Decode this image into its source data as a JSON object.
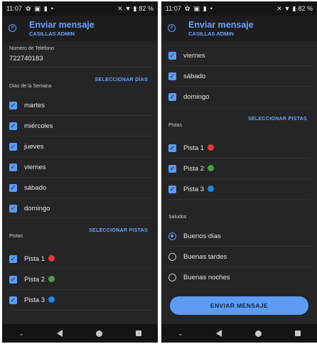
{
  "status": {
    "time": "11:07",
    "battery": "82 %"
  },
  "header": {
    "title": "Enviar mensaje",
    "subtitle": "CASILLAS ADMIN"
  },
  "colors": {
    "accent": "#5b9bf4",
    "background": "#252527",
    "red": "#e53935",
    "green": "#43a047",
    "blue": "#1e88e5"
  },
  "phone_field": {
    "label": "Número de Teléfono",
    "value": "722740183"
  },
  "days": {
    "label": "Días de la Semana",
    "select_label": "SELECCIONAR DÍAS",
    "items": [
      "martes",
      "miércoles",
      "jueves",
      "viernes",
      "sábado",
      "domingo"
    ]
  },
  "tracks": {
    "label": "Pistas",
    "select_label": "SELECCIONAR PISTAS",
    "items": [
      "Pista 1",
      "Pista 2",
      "Pista 3"
    ]
  },
  "greetings": {
    "label": "Saludos",
    "options": [
      "Buenos días",
      "Buenas tardes",
      "Buenas noches"
    ],
    "selected": "Buenos días"
  },
  "send_button": "ENVIAR MENSAJE",
  "icons": {
    "close": "close-circle-icon",
    "checkbox": "checkbox-checked-icon",
    "radio": "radio-icon",
    "nav": [
      "chevron-down-icon",
      "back-icon",
      "home-icon",
      "recents-icon"
    ]
  }
}
